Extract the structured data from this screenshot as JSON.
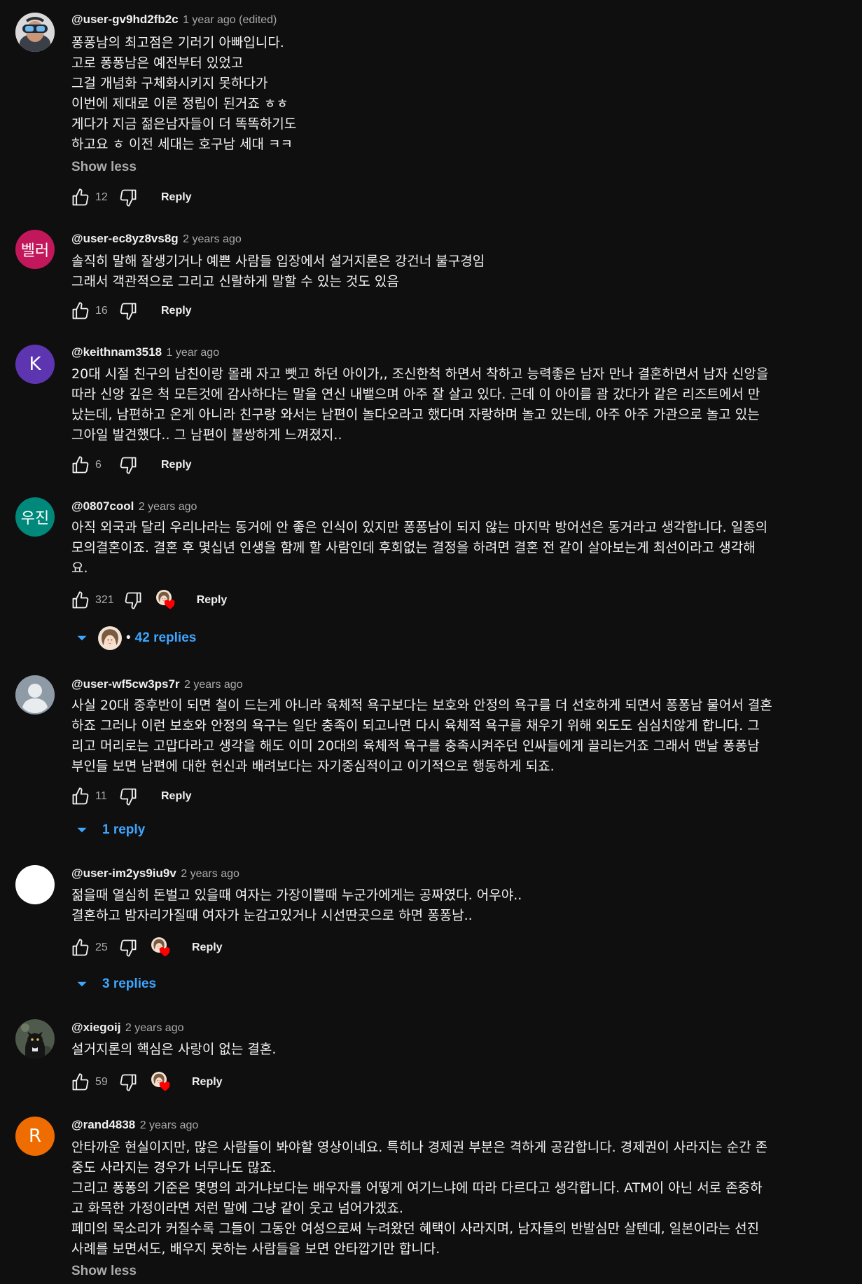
{
  "colors": {
    "background": "#0f0f0f",
    "text": "#f1f1f1",
    "secondary": "#aaaaaa",
    "link": "#3ea6ff",
    "heart": "#ff0000"
  },
  "comments": [
    {
      "author": "@user-gv9hd2fb2c",
      "time": "1 year ago (edited)",
      "avatar_icon": "vr-headset-avatar",
      "lines": [
        "퐁퐁남의 최고점은 기러기 아빠입니다.",
        "고로 퐁퐁남은 예전부터 있었고",
        "그걸 개념화 구체화시키지 못하다가",
        "이번에 제대로 이론 정립이 된거죠 ㅎㅎ",
        "게다가 지금 젊은남자들이 더 똑똑하기도",
        "하고요 ㅎ 이전 세대는 호구남 세대 ㅋㅋ"
      ],
      "show_less": "Show less",
      "likes": "12",
      "reply_label": "Reply"
    },
    {
      "author": "@user-ec8yz8vs8g",
      "time": "2 years ago",
      "avatar_text": "벨러",
      "avatar_color": "#c2185b",
      "lines": [
        "솔직히 말해 잘생기거나 예쁜 사람들 입장에서 설거지론은 강건너 불구경임",
        "그래서 객관적으로 그리고 신랄하게 말할 수 있는 것도 있음"
      ],
      "likes": "16",
      "reply_label": "Reply"
    },
    {
      "author": "@keithnam3518",
      "time": "1 year ago",
      "avatar_text": "K",
      "avatar_color": "#5e35b1",
      "lines": [
        "20대 시절 친구의 남친이랑 몰래 자고 뺏고 하던 아이가,, 조신한척 하면서 착하고 능력좋은 남자 만나 결혼하면서 남자 신앙을",
        "따라 신앙 깊은 척 모든것에 감사하다는 말을 연신 내뱉으며 아주 잘 살고 있다. 근데 이  아이를 괌 갔다가 같은 리즈트에서 만",
        "났는데, 남편하고 온게 아니라 친구랑 와서는 남편이 놀다오라고 했다며 자랑하며 놀고 있는데, 아주 아주 가관으로 놀고 있는",
        "그아일 발견했다.. 그 남편이 불쌍하게 느껴졌지.."
      ],
      "likes": "6",
      "reply_label": "Reply"
    },
    {
      "author": "@0807cool",
      "time": "2 years ago",
      "avatar_text": "우진",
      "avatar_color": "#00897b",
      "lines": [
        "아직 외국과 달리 우리나라는 동거에 안 좋은 인식이 있지만 퐁퐁남이 되지 않는 마지막 방어선은 동거라고 생각합니다. 일종의",
        "모의결혼이죠. 결혼 후 몇십년 인생을 함께 할 사람인데 후회없는 결정을 하려면 결혼 전 같이 살아보는게 최선이라고 생각해",
        "요."
      ],
      "likes": "321",
      "reply_label": "Reply",
      "hearted": true,
      "replies_label": "42 replies",
      "replies_bullet": "•"
    },
    {
      "author": "@user-wf5cw3ps7r",
      "time": "2 years ago",
      "avatar_icon": "default-person-avatar",
      "lines": [
        "사실 20대 중후반이 되면 철이 드는게 아니라 육체적 욕구보다는 보호와 안정의 욕구를 더 선호하게 되면서 퐁퐁남 물어서 결혼",
        "하죠 그러나 이런 보호와 안정의 욕구는 일단 충족이 되고나면 다시 육체적 욕구를 채우기 위해 외도도 심심치않게 합니다. 그",
        "리고 머리로는 고맙다라고 생각을 해도 이미 20대의 육체적 욕구를 충족시켜주던 인싸들에게 끌리는거죠 그래서 맨날 퐁퐁남",
        "부인들 보면 남편에 대한 헌신과 배려보다는 자기중심적이고 이기적으로 행동하게 되죠."
      ],
      "likes": "11",
      "reply_label": "Reply",
      "replies_label": "1 reply"
    },
    {
      "author": "@user-im2ys9iu9v",
      "time": "2 years ago",
      "avatar_color": "#ffffff",
      "lines": [
        "젊을때 열심히 돈벌고 있을때 여자는 가장이쁠때 누군가에게는 공짜였다. 어우야..",
        "결혼하고 밤자리가질때 여자가 눈감고있거나 시선딴곳으로 하면 퐁퐁남.."
      ],
      "likes": "25",
      "reply_label": "Reply",
      "hearted": true,
      "replies_label": "3 replies"
    },
    {
      "author": "@xiegoij",
      "time": "2 years ago",
      "avatar_icon": "black-cat-avatar",
      "lines": [
        "설거지론의 핵심은 사랑이 없는 결혼."
      ],
      "likes": "59",
      "reply_label": "Reply",
      "hearted": true
    },
    {
      "author": "@rand4838",
      "time": "2 years ago",
      "avatar_text": "R",
      "avatar_color": "#ef6c00",
      "lines": [
        "안타까운 현실이지만, 많은 사람들이 봐야할 영상이네요. 특히나 경제권 부분은 격하게 공감합니다. 경제권이 사라지는 순간 존",
        "중도 사라지는 경우가 너무나도 많죠.",
        "그리고 퐁퐁의 기준은 몇명의 과거냐보다는 배우자를 어떻게 여기느냐에 따라 다르다고 생각합니다. ATM이 아닌 서로 존중하",
        "고 화목한 가정이라면 저런 말에 그냥 같이 웃고 넘어가겠죠.",
        " 페미의 목소리가 커질수록 그들이 그동안 여성으로써 누려왔던 혜택이 사라지며, 남자들의 반발심만 살텐데, 일본이라는 선진",
        "사례를 보면서도, 배우지 못하는 사람들을 보면 안타깝기만 합니다."
      ],
      "show_less": "Show less"
    }
  ]
}
